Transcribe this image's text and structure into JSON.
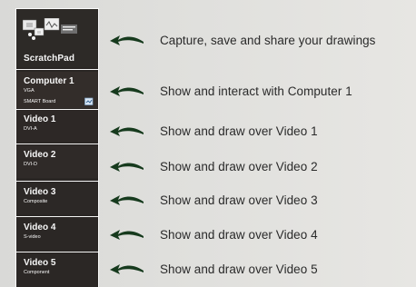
{
  "sidebar": {
    "scratchpad": {
      "label": "ScratchPad",
      "icon": "scratchpad-icon"
    },
    "items": [
      {
        "id": "computer1",
        "title": "Computer 1",
        "subtitle": "VGA",
        "subtitle2": "SMART Board",
        "icon": "smart-board-icon"
      },
      {
        "id": "video1",
        "title": "Video 1",
        "subtitle": "DVI-A"
      },
      {
        "id": "video2",
        "title": "Video 2",
        "subtitle": "DVI-D"
      },
      {
        "id": "video3",
        "title": "Video 3",
        "subtitle": "Composite"
      },
      {
        "id": "video4",
        "title": "Video 4",
        "subtitle": "S-video"
      },
      {
        "id": "video5",
        "title": "Video 5",
        "subtitle": "Component"
      }
    ]
  },
  "descriptions": [
    "Capture, save and share your drawings",
    "Show and interact with Computer 1",
    "Show and draw over Video 1",
    "Show and draw over Video 2",
    "Show and draw over Video 3",
    "Show and draw over Video 4",
    "Show and draw over Video 5"
  ],
  "colors": {
    "sidebar_bg": "#2b2725",
    "arrow": "#173a1d",
    "text": "#2a2a2a",
    "page_bg": "#dfdfdc"
  }
}
